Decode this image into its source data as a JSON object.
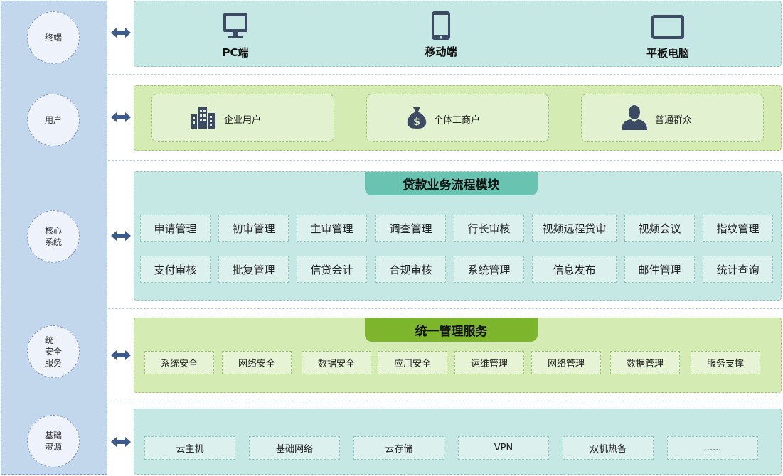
{
  "layers": [
    {
      "label": "终端"
    },
    {
      "label": "用户"
    },
    {
      "label": "核心\n系统"
    },
    {
      "label": "统一\n安全\n服务"
    },
    {
      "label": "基础\n资源"
    }
  ],
  "terminal": {
    "devices": [
      {
        "label": "PC端",
        "icon": "monitor-icon"
      },
      {
        "label": "移动端",
        "icon": "smartphone-icon"
      },
      {
        "label": "平板电脑",
        "icon": "tablet-icon"
      }
    ]
  },
  "users": {
    "items": [
      {
        "label": "企业用户",
        "icon": "buildings-icon"
      },
      {
        "label": "个体工商户",
        "icon": "money-bag-icon"
      },
      {
        "label": "普通群众",
        "icon": "person-icon"
      }
    ]
  },
  "core": {
    "title": "贷款业务流程模块",
    "row1": [
      "申请管理",
      "初审管理",
      "主审管理",
      "调查管理",
      "行长审核",
      "视频远程贷审",
      "视频会议",
      "指纹管理"
    ],
    "row2": [
      "支付审核",
      "批复管理",
      "信贷会计",
      "合规审核",
      "系统管理",
      "信息发布",
      "邮件管理",
      "统计查询"
    ]
  },
  "security": {
    "title": "统一管理服务",
    "items": [
      "系统安全",
      "网络安全",
      "数据安全",
      "应用安全",
      "运维管理",
      "网络管理",
      "数据管理",
      "服务支撑"
    ]
  },
  "infra": {
    "items": [
      "云主机",
      "基础网络",
      "云存储",
      "VPN",
      "双机热备",
      "......"
    ]
  },
  "colors": {
    "sidebar": "#c2d6ec",
    "teal_panel": "#c6e8e4",
    "green_panel": "#d5ebb4",
    "teal_tab": "#68c4b0",
    "green_tab": "#7db52c",
    "icon": "#3c4a64",
    "arrow": "#3c5a8c"
  }
}
